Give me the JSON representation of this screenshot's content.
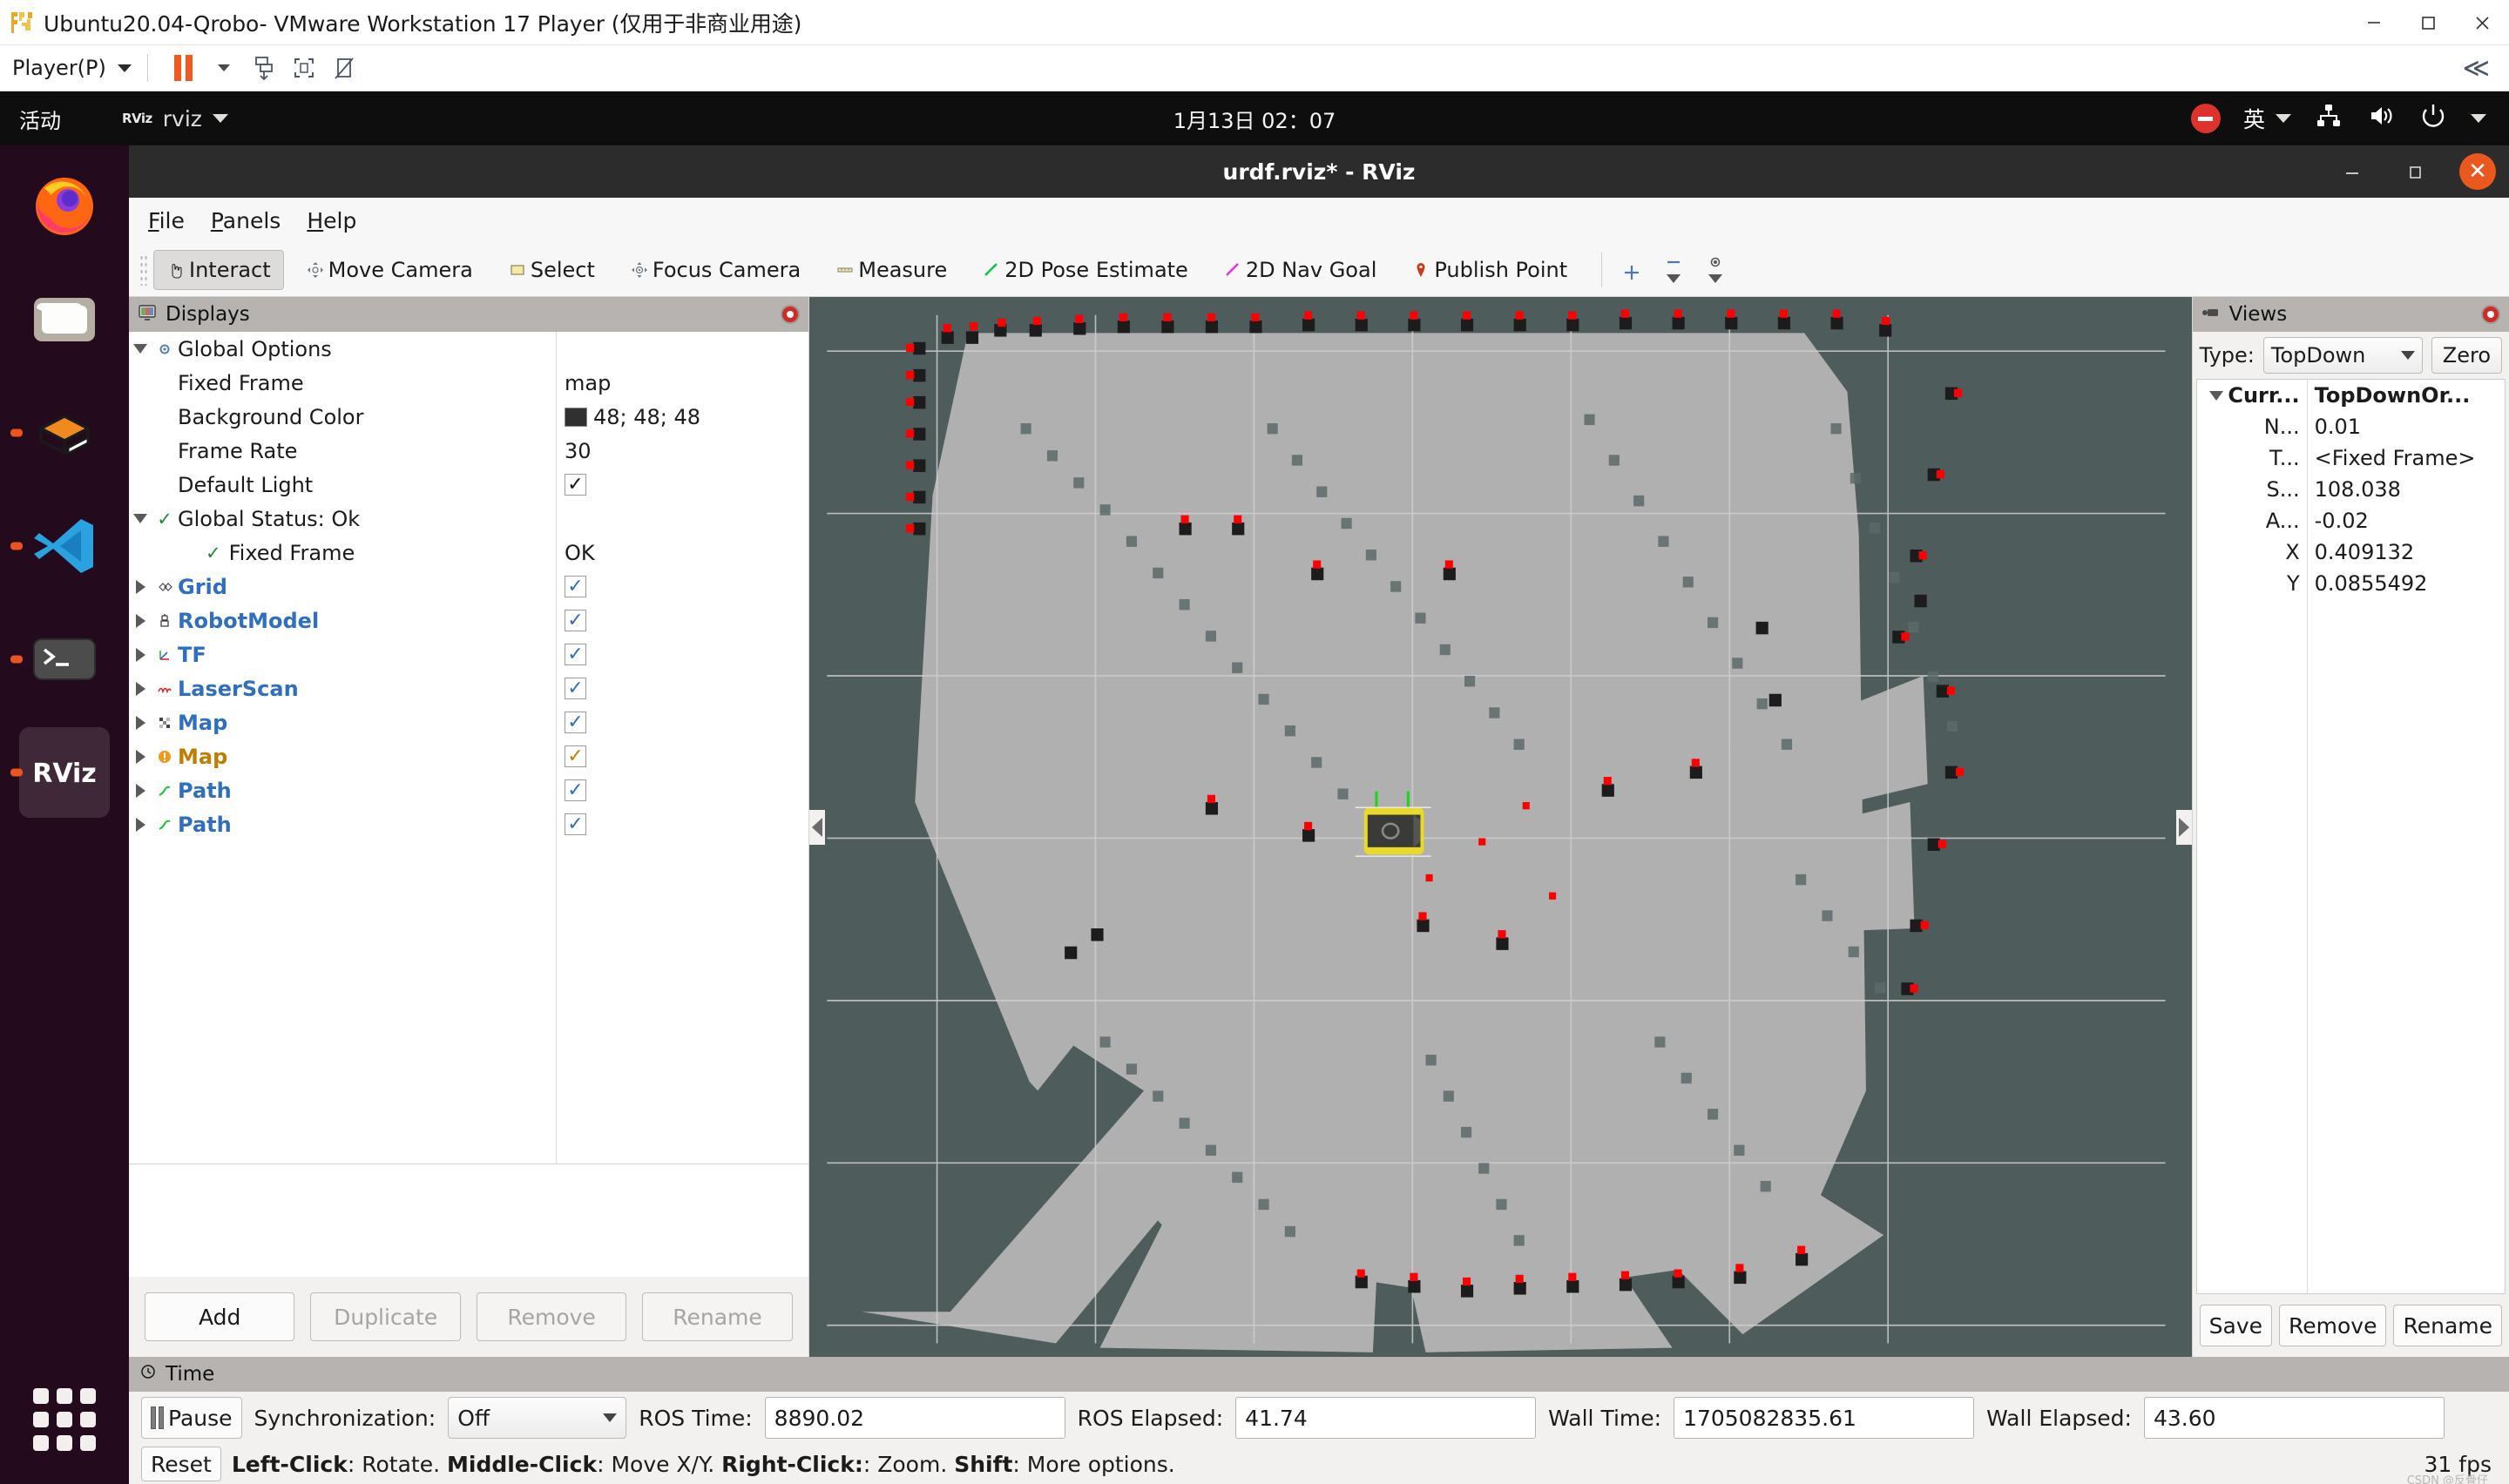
{
  "vmware": {
    "title": "Ubuntu20.04-Qrobo- VMware Workstation 17 Player (仅用于非商业用途)",
    "player_menu": "Player(P)",
    "minimize": "—",
    "maximize": "□",
    "close": "✕",
    "collapse": "≪",
    "icons": [
      "vmware-logo-icon",
      "pause-icon",
      "dropdown-caret-icon",
      "send-ctrl-alt-del-icon",
      "fullscreen-icon",
      "unity-mode-icon"
    ]
  },
  "gnome": {
    "activities": "活动",
    "app_name": "rviz",
    "app_badge": "RViz",
    "clock": "1月13日 02：07",
    "input_method": "英",
    "icons": [
      "record-indicator-icon",
      "network-icon",
      "volume-icon",
      "power-icon",
      "system-menu-caret-icon"
    ]
  },
  "dock": {
    "items": [
      {
        "name": "firefox",
        "running": false
      },
      {
        "name": "files",
        "running": false
      },
      {
        "name": "ubuntu-software",
        "running": true
      },
      {
        "name": "vscode",
        "running": true
      },
      {
        "name": "terminal",
        "running": true
      },
      {
        "name": "rviz",
        "running": true,
        "focused": true
      }
    ],
    "show_apps": "show-applications"
  },
  "rviz": {
    "window_title": "urdf.rviz* - RViz",
    "window_buttons": {
      "minimize": "—",
      "maximize": "❐",
      "close": "✕"
    },
    "menus": [
      "File",
      "Panels",
      "Help"
    ],
    "tools": [
      {
        "label": "Interact",
        "icon": "hand-cursor-icon",
        "selected": true
      },
      {
        "label": "Move Camera",
        "icon": "move-camera-icon",
        "selected": false
      },
      {
        "label": "Select",
        "icon": "select-rect-icon",
        "selected": false
      },
      {
        "label": "Focus Camera",
        "icon": "focus-camera-icon",
        "selected": false
      },
      {
        "label": "Measure",
        "icon": "ruler-icon",
        "selected": false
      },
      {
        "label": "2D Pose Estimate",
        "icon": "pose-arrow-green-icon",
        "selected": false
      },
      {
        "label": "2D Nav Goal",
        "icon": "nav-goal-magenta-icon",
        "selected": false
      },
      {
        "label": "Publish Point",
        "icon": "map-pin-icon",
        "selected": false
      }
    ],
    "toolbar_extra": [
      "add-tool-icon",
      "remove-tool-icon",
      "tool-properties-icon"
    ]
  },
  "displays": {
    "title": "Displays",
    "panel_icon": "displays-panel-icon",
    "rows": [
      {
        "label": "Global Options",
        "value": "",
        "kind": "group",
        "expanded": true,
        "icon": "gear-icon",
        "indent": 0
      },
      {
        "label": "Fixed Frame",
        "value": "map",
        "kind": "prop",
        "indent": 1
      },
      {
        "label": "Background Color",
        "value": "48; 48; 48",
        "kind": "color",
        "swatch": "#303030",
        "indent": 1
      },
      {
        "label": "Frame Rate",
        "value": "30",
        "kind": "prop",
        "indent": 1
      },
      {
        "label": "Default Light",
        "value": "",
        "kind": "check",
        "checked": true,
        "indent": 1
      },
      {
        "label": "Global Status: Ok",
        "value": "",
        "kind": "status",
        "expanded": true,
        "indent": 0
      },
      {
        "label": "Fixed Frame",
        "value": "OK",
        "kind": "substatus",
        "indent": 2
      },
      {
        "label": "Grid",
        "value": "",
        "kind": "display",
        "color": "blue",
        "icon": "grid-icon",
        "checked": true,
        "indent": 0
      },
      {
        "label": "RobotModel",
        "value": "",
        "kind": "display",
        "color": "blue",
        "icon": "robot-icon",
        "checked": true,
        "indent": 0
      },
      {
        "label": "TF",
        "value": "",
        "kind": "display",
        "color": "blue",
        "icon": "tf-axes-icon",
        "checked": true,
        "indent": 0
      },
      {
        "label": "LaserScan",
        "value": "",
        "kind": "display",
        "color": "blue",
        "icon": "laserscan-icon",
        "checked": true,
        "indent": 0
      },
      {
        "label": "Map",
        "value": "",
        "kind": "display",
        "color": "blue",
        "icon": "map-grid-icon",
        "checked": true,
        "indent": 0
      },
      {
        "label": "Map",
        "value": "",
        "kind": "display",
        "color": "orange",
        "icon": "map-warning-icon",
        "checked": true,
        "indent": 0
      },
      {
        "label": "Path",
        "value": "",
        "kind": "display",
        "color": "blue",
        "icon": "path-green-icon",
        "checked": true,
        "indent": 0
      },
      {
        "label": "Path",
        "value": "",
        "kind": "display",
        "color": "blue",
        "icon": "path-green-icon",
        "checked": true,
        "indent": 0
      }
    ],
    "buttons": [
      {
        "label": "Add",
        "enabled": true
      },
      {
        "label": "Duplicate",
        "enabled": false
      },
      {
        "label": "Remove",
        "enabled": false
      },
      {
        "label": "Rename",
        "enabled": false
      }
    ]
  },
  "views": {
    "title": "Views",
    "panel_icon": "views-panel-icon",
    "type_label": "Type:",
    "type_value": "TopDown",
    "zero_button": "Zero",
    "rows": [
      {
        "key": "Curr...",
        "value": "TopDownOr...",
        "bold": true,
        "expanded": true
      },
      {
        "key": "N...",
        "value": "0.01",
        "bold": false
      },
      {
        "key": "T...",
        "value": "<Fixed Frame>",
        "bold": false
      },
      {
        "key": "S...",
        "value": "108.038",
        "bold": false
      },
      {
        "key": "A...",
        "value": "-0.02",
        "bold": false
      },
      {
        "key": "X",
        "value": "0.409132",
        "bold": false
      },
      {
        "key": "Y",
        "value": "0.0855492",
        "bold": false
      }
    ],
    "buttons": [
      "Save",
      "Remove",
      "Rename"
    ]
  },
  "time": {
    "title": "Time",
    "panel_icon": "clock-icon",
    "pause_label": "Pause",
    "sync_label": "Synchronization:",
    "sync_value": "Off",
    "fields": [
      {
        "label": "ROS Time:",
        "value": "8890.02"
      },
      {
        "label": "ROS Elapsed:",
        "value": "41.74"
      },
      {
        "label": "Wall Time:",
        "value": "1705082835.61"
      },
      {
        "label": "Wall Elapsed:",
        "value": "43.60"
      }
    ],
    "reset_label": "Reset",
    "hint_parts": [
      {
        "text": "Left-Click",
        "bold": true
      },
      {
        "text": ": Rotate. ",
        "bold": false
      },
      {
        "text": "Middle-Click",
        "bold": true
      },
      {
        "text": ": Move X/Y. ",
        "bold": false
      },
      {
        "text": "Right-Click:",
        "bold": true
      },
      {
        "text": ": Zoom. ",
        "bold": false
      },
      {
        "text": "Shift",
        "bold": true
      },
      {
        "text": ": More options.",
        "bold": false
      }
    ],
    "fps": "31 fps",
    "watermark": "CSDN @反骨仔"
  },
  "view3d": {
    "background_color": "#4e5c5c",
    "free_space_color": "#b0b0b0",
    "unknown_color": "#4e5c5c",
    "occupied_color": "#1c1c1c",
    "laser_color": "#ff0000",
    "grid_color": "#cfcfcf",
    "robot_body_color": "#3a3a38",
    "robot_trim_color": "#e8d92a",
    "collapse_left": "collapse-left-handle",
    "collapse_right": "collapse-right-handle"
  }
}
